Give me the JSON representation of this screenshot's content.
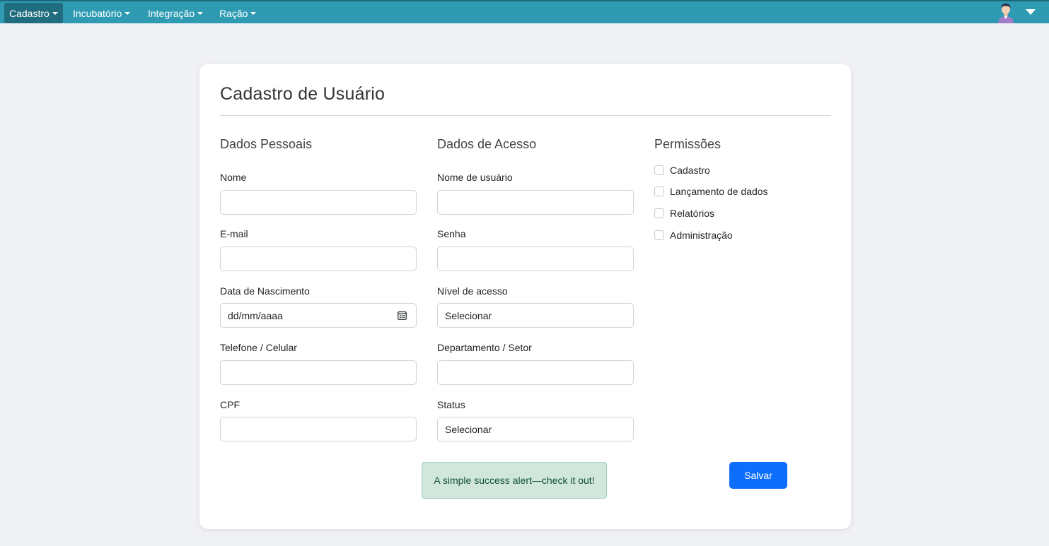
{
  "navbar": {
    "items": [
      {
        "label": "Cadastro"
      },
      {
        "label": "Incubatório"
      },
      {
        "label": "Integração"
      },
      {
        "label": "Ração"
      }
    ],
    "avatar_icon": "user-avatar-icon",
    "profile_menu_icon": "caret-down-icon",
    "color": "#2e9bb3",
    "active_color": "#1f6d7e"
  },
  "form": {
    "title": "Cadastro de Usuário",
    "personal": {
      "heading": "Dados Pessoais",
      "name_label": "Nome",
      "name_value": "",
      "email_label": "E-mail",
      "email_value": "",
      "birth_label": "Data de Nascimento",
      "birth_placeholder": "dd/mm/aaaa",
      "phone_label": "Telefone / Celular",
      "phone_value": "",
      "cpf_label": "CPF",
      "cpf_value": ""
    },
    "access": {
      "heading": "Dados de Acesso",
      "username_label": "Nome de usuário",
      "username_value": "",
      "password_label": "Senha",
      "password_value": "",
      "level_label": "Nível de acesso",
      "level_value": "Selecionar",
      "department_label": "Departamento / Setor",
      "department_value": "",
      "status_label": "Status",
      "status_value": "Selecionar"
    },
    "permissions": {
      "heading": "Permissões",
      "items": [
        {
          "label": "Cadastro",
          "checked": false
        },
        {
          "label": "Lançamento de dados",
          "checked": false
        },
        {
          "label": "Relatórios",
          "checked": false
        },
        {
          "label": "Administração",
          "checked": false
        }
      ]
    },
    "alert_text": "A simple success alert—check it out!",
    "save_label": "Salvar",
    "save_color": "#0d6efd",
    "alert_color": "#d1e7dd"
  }
}
